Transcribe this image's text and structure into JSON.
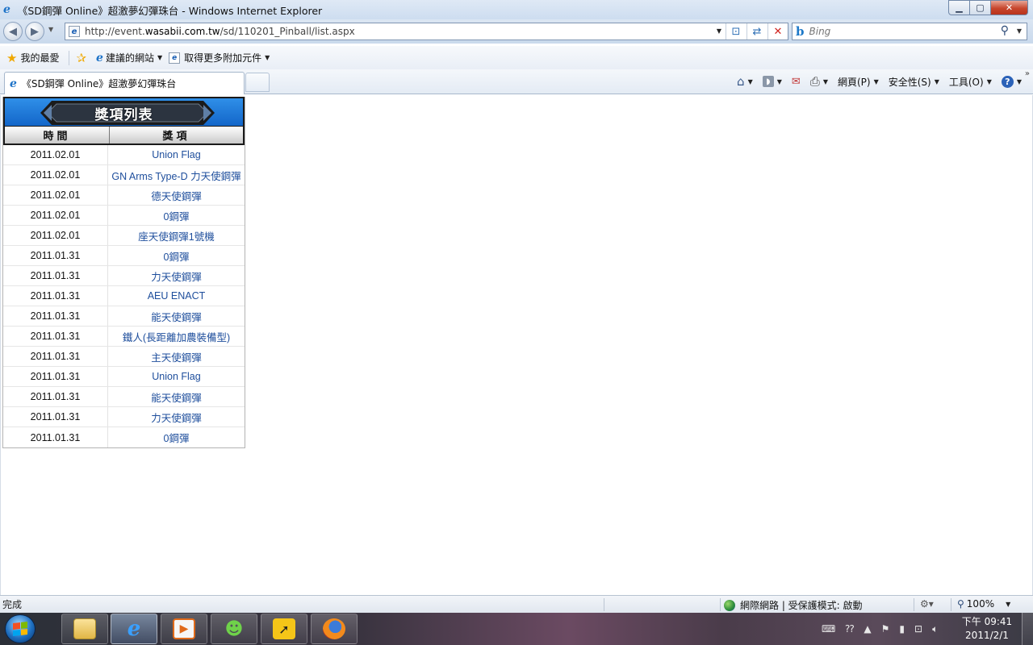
{
  "window": {
    "title": "《SD鋼彈 Online》超激夢幻彈珠台 - Windows Internet Explorer"
  },
  "addressbar": {
    "url_prefix": "http://event.",
    "url_domain": "wasabii.com.tw",
    "url_path": "/sd/110201_Pinball/list.aspx"
  },
  "search": {
    "placeholder": "Bing"
  },
  "favorites": {
    "favorites_label": "我的最愛",
    "suggested_sites": "建議的網站",
    "get_addons": "取得更多附加元件"
  },
  "tab": {
    "label": "《SD鋼彈 Online》超激夢幻彈珠台"
  },
  "commandbar": {
    "page": "網頁(P)",
    "safety": "安全性(S)",
    "tools": "工具(O)"
  },
  "prize_list": {
    "title": "獎項列表",
    "col_time": "時間",
    "col_prize": "獎項",
    "rows": [
      {
        "date": "2011.02.01",
        "prize": "Union Flag"
      },
      {
        "date": "2011.02.01",
        "prize": "GN Arms Type-D 力天使鋼彈"
      },
      {
        "date": "2011.02.01",
        "prize": "德天使鋼彈"
      },
      {
        "date": "2011.02.01",
        "prize": "0鋼彈"
      },
      {
        "date": "2011.02.01",
        "prize": "座天使鋼彈1號機"
      },
      {
        "date": "2011.01.31",
        "prize": "0鋼彈"
      },
      {
        "date": "2011.01.31",
        "prize": "力天使鋼彈"
      },
      {
        "date": "2011.01.31",
        "prize": "AEU ENACT"
      },
      {
        "date": "2011.01.31",
        "prize": "能天使鋼彈"
      },
      {
        "date": "2011.01.31",
        "prize": "鐵人(長距離加農裝備型)"
      },
      {
        "date": "2011.01.31",
        "prize": "主天使鋼彈"
      },
      {
        "date": "2011.01.31",
        "prize": "Union Flag"
      },
      {
        "date": "2011.01.31",
        "prize": "能天使鋼彈"
      },
      {
        "date": "2011.01.31",
        "prize": "力天使鋼彈"
      },
      {
        "date": "2011.01.31",
        "prize": "0鋼彈"
      }
    ]
  },
  "statusbar": {
    "status": "完成",
    "zone": "網際網路 | 受保護模式: 啟動",
    "zoom": "100%"
  },
  "taskbar": {
    "clock_period_time": "下午 09:41",
    "clock_date": "2011/2/1"
  },
  "colors": {
    "header_blue": "#1a74d6",
    "link_blue": "#1e4e9c"
  }
}
